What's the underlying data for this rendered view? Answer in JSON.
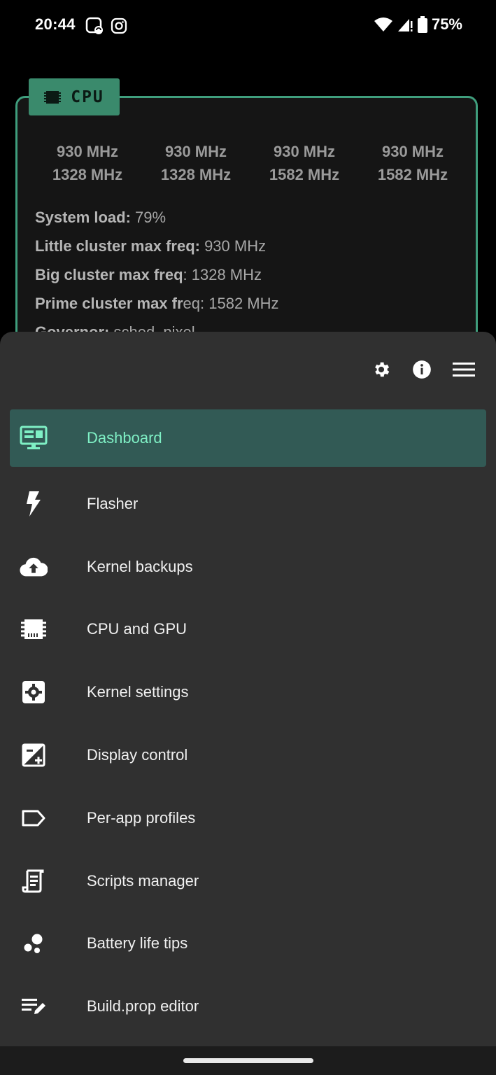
{
  "status": {
    "time": "20:44",
    "battery": "75%",
    "icons_left": [
      "sync-app-icon",
      "instagram-icon"
    ],
    "icons_right": [
      "wifi-icon",
      "signal-icon",
      "battery-icon"
    ]
  },
  "cpu_card": {
    "title": "CPU",
    "cores": [
      {
        "min": "930 MHz",
        "max": "1328 MHz"
      },
      {
        "min": "930 MHz",
        "max": "1328 MHz"
      },
      {
        "min": "930 MHz",
        "max": "1582 MHz"
      },
      {
        "min": "930 MHz",
        "max": "1582 MHz"
      }
    ],
    "stats": [
      {
        "label": "System load:",
        "value": " 79%"
      },
      {
        "label": "Little cluster max freq:",
        "value": " 930 MHz"
      },
      {
        "label": "Big cluster max freq",
        "value": ": 1328 MHz"
      },
      {
        "label": "Prime cluster max fr",
        "value": "eq: 1582 MHz"
      },
      {
        "label": "Governor:",
        "value": " sched_pixel"
      }
    ]
  },
  "drawer": {
    "top_icons": [
      "settings-icon",
      "info-icon",
      "menu-icon"
    ],
    "items": [
      {
        "label": "Dashboard",
        "icon": "dashboard-icon",
        "active": true
      },
      {
        "label": "Flasher",
        "icon": "flash-icon"
      },
      {
        "label": "Kernel backups",
        "icon": "cloud-upload-icon"
      },
      {
        "label": "CPU and GPU",
        "icon": "chip-icon"
      },
      {
        "label": "Kernel settings",
        "icon": "gear-box-icon"
      },
      {
        "label": "Display control",
        "icon": "exposure-icon"
      },
      {
        "label": "Per-app profiles",
        "icon": "label-icon"
      },
      {
        "label": "Scripts manager",
        "icon": "script-icon"
      },
      {
        "label": "Battery life tips",
        "icon": "bubbles-icon"
      },
      {
        "label": "Build.prop editor",
        "icon": "edit-list-icon"
      }
    ]
  },
  "colors": {
    "accent": "#3f9e7d",
    "active_bg": "#325a55",
    "active_text": "#7ff0c5",
    "drawer_bg": "#303030"
  }
}
